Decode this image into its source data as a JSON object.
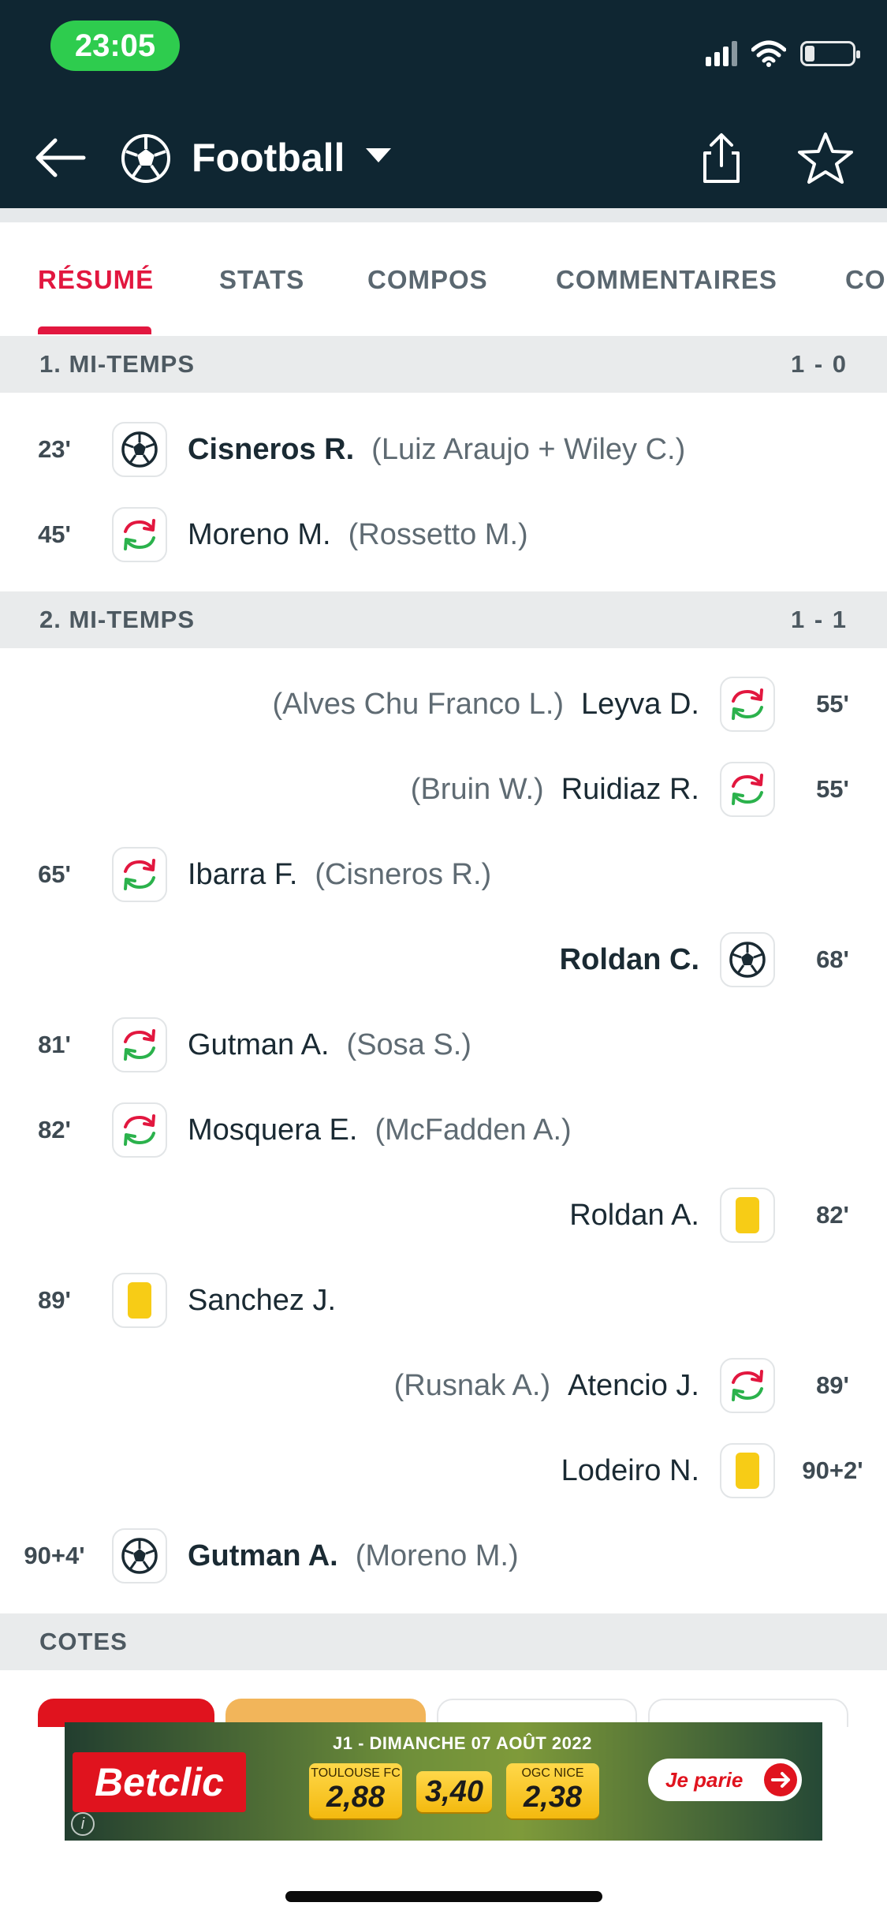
{
  "status_bar": {
    "time": "23:05"
  },
  "header": {
    "title": "Football"
  },
  "tabs": [
    {
      "label": "RÉSUMÉ",
      "active": true
    },
    {
      "label": "STATS"
    },
    {
      "label": "COMPOS"
    },
    {
      "label": "COMMENTAIRES"
    },
    {
      "label": "CO"
    }
  ],
  "sections": [
    {
      "label": "1. MI-TEMPS",
      "score": "1 - 0"
    },
    {
      "label": "2. MI-TEMPS",
      "score": "1 - 1"
    },
    {
      "label": "COTES"
    }
  ],
  "incidents": [
    {
      "minute": "23'",
      "side": "home",
      "type": "goal",
      "player": "Cisneros R.",
      "extra": "(Luiz Araujo + Wiley C.)"
    },
    {
      "minute": "45'",
      "side": "home",
      "type": "substitution",
      "player": "Moreno M.",
      "extra": "(Rossetto M.)"
    },
    {
      "minute": "55'",
      "side": "away",
      "type": "substitution",
      "player": "Leyva D.",
      "extra": "(Alves Chu Franco L.)"
    },
    {
      "minute": "55'",
      "side": "away",
      "type": "substitution",
      "player": "Ruidiaz R.",
      "extra": "(Bruin W.)"
    },
    {
      "minute": "65'",
      "side": "home",
      "type": "substitution",
      "player": "Ibarra F.",
      "extra": "(Cisneros R.)"
    },
    {
      "minute": "68'",
      "side": "away",
      "type": "goal",
      "player": "Roldan C.",
      "extra": ""
    },
    {
      "minute": "81'",
      "side": "home",
      "type": "substitution",
      "player": "Gutman A.",
      "extra": "(Sosa S.)"
    },
    {
      "minute": "82'",
      "side": "home",
      "type": "substitution",
      "player": "Mosquera E.",
      "extra": "(McFadden A.)"
    },
    {
      "minute": "82'",
      "side": "away",
      "type": "yellow-card",
      "player": "Roldan A.",
      "extra": ""
    },
    {
      "minute": "89'",
      "side": "home",
      "type": "yellow-card",
      "player": "Sanchez J.",
      "extra": ""
    },
    {
      "minute": "89'",
      "side": "away",
      "type": "substitution",
      "player": "Atencio J.",
      "extra": "(Rusnak A.)"
    },
    {
      "minute": "90+2'",
      "side": "away",
      "type": "yellow-card",
      "player": "Lodeiro N.",
      "extra": ""
    },
    {
      "minute": "90+4'",
      "side": "home",
      "type": "goal",
      "player": "Gutman A.",
      "extra": "(Moreno M.)"
    }
  ],
  "ad": {
    "brand": "Betclic",
    "headline": "J1 - DIMANCHE 07 AOÛT 2022",
    "odds": [
      {
        "team": "TOULOUSE FC",
        "value": "2,88"
      },
      {
        "team": "",
        "value": "3,40"
      },
      {
        "team": "OGC NICE",
        "value": "2,38"
      }
    ],
    "cta": "Je parie",
    "info": "i"
  },
  "colors": {
    "header_bg": "#0f2632",
    "accent": "#e2173f",
    "status_green": "#2ecc4e",
    "yellow_card": "#f7cc16",
    "sub_in": "#2bb24c",
    "sub_out": "#e2173f"
  },
  "icons": {
    "back": "arrow-left-icon",
    "sport": "football-icon",
    "dropdown": "caret-down-icon",
    "share": "share-icon",
    "favorite": "star-icon",
    "goal": "football-icon",
    "substitution": "substitution-icon",
    "yellow_card": "yellow-card-icon"
  }
}
